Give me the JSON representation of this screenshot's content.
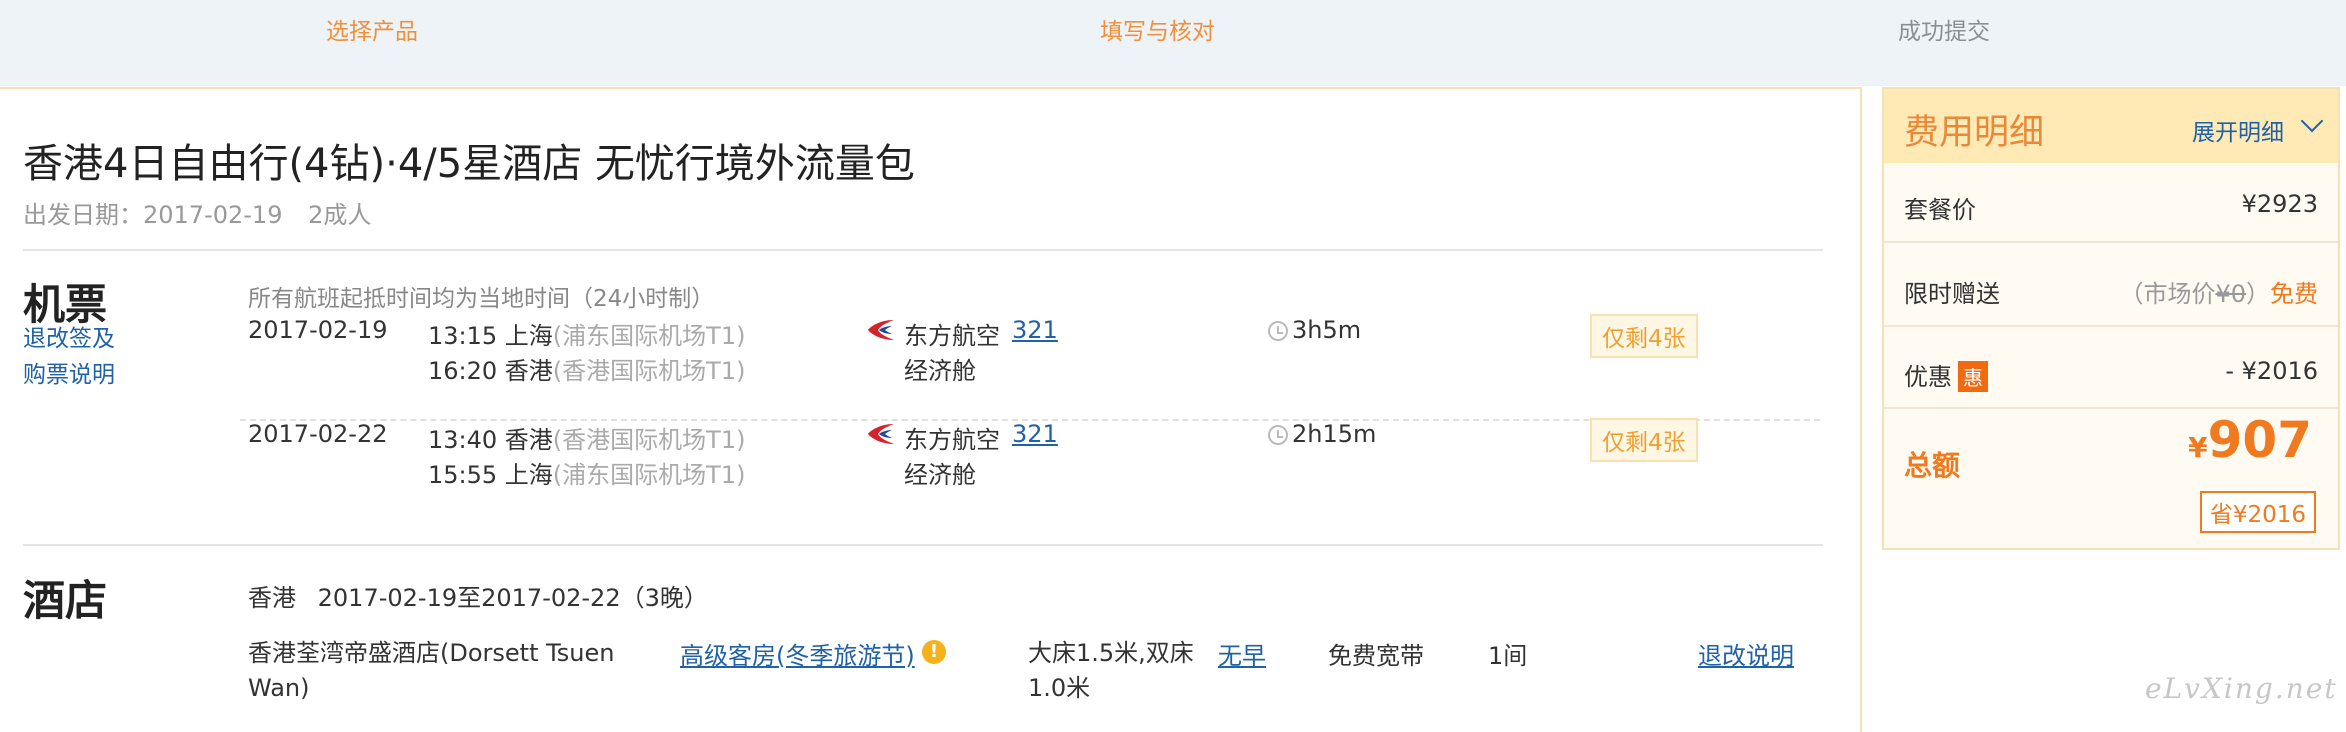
{
  "steps": [
    "选择产品",
    "填写与核对",
    "成功提交"
  ],
  "product": {
    "title": "香港4日自由行(4钻)·4/5星酒店 无忧行境外流量包",
    "depart_label": "出发日期：2017-02-19",
    "people": "2成人"
  },
  "flight": {
    "section_title": "机票",
    "refund_link_line1": "退改签及",
    "refund_link_line2": "购票说明",
    "note": "所有航班起抵时间均为当地时间（24小时制）",
    "legs": [
      {
        "date": "2017-02-19",
        "dep_time_city": "13:15 上海",
        "dep_airport": "(浦东国际机场T1)",
        "arr_time_city": "16:20 香港",
        "arr_airport": "(香港国际机场T1)",
        "airline": "东方航空",
        "aircraft": "321",
        "cabin": "经济舱",
        "duration": "3h5m",
        "remaining": "仅剩4张"
      },
      {
        "date": "2017-02-22",
        "dep_time_city": "13:40 香港",
        "dep_airport": "(香港国际机场T1)",
        "arr_time_city": "15:55 上海",
        "arr_airport": "(浦东国际机场T1)",
        "airline": "东方航空",
        "aircraft": "321",
        "cabin": "经济舱",
        "duration": "2h15m",
        "remaining": "仅剩4张"
      }
    ]
  },
  "hotel": {
    "section_title": "酒店",
    "city": "香港",
    "dates": "2017-02-19至2017-02-22（3晚）",
    "name_line1": "香港荃湾帝盛酒店(Dorsett Tsuen",
    "name_line2": "Wan)",
    "room_type": "高级客房(冬季旅游节)",
    "bed_line1": "大床1.5米,双床",
    "bed_line2": "1.0米",
    "breakfast": "无早",
    "broadband": "免费宽带",
    "rooms": "1间",
    "refund_link": "退改说明"
  },
  "fees": {
    "title": "费用明细",
    "expand": "展开明细",
    "package_label": "套餐价",
    "package_price": "¥2923",
    "gift_label": "限时赠送",
    "gift_market_prefix": "（市场价",
    "gift_market_price": "¥0",
    "gift_market_suffix": "）",
    "gift_free": "免费",
    "discount_label": "优惠",
    "discount_badge": "惠",
    "discount_amount": "- ¥2016",
    "total_label": "总额",
    "total_currency": "¥",
    "total_amount": "907",
    "save_badge": "省¥2016"
  },
  "watermark": "eLvXing.net",
  "colors": {
    "accent": "#f0903a",
    "link": "#2062a8",
    "price": "#f07a1f"
  }
}
